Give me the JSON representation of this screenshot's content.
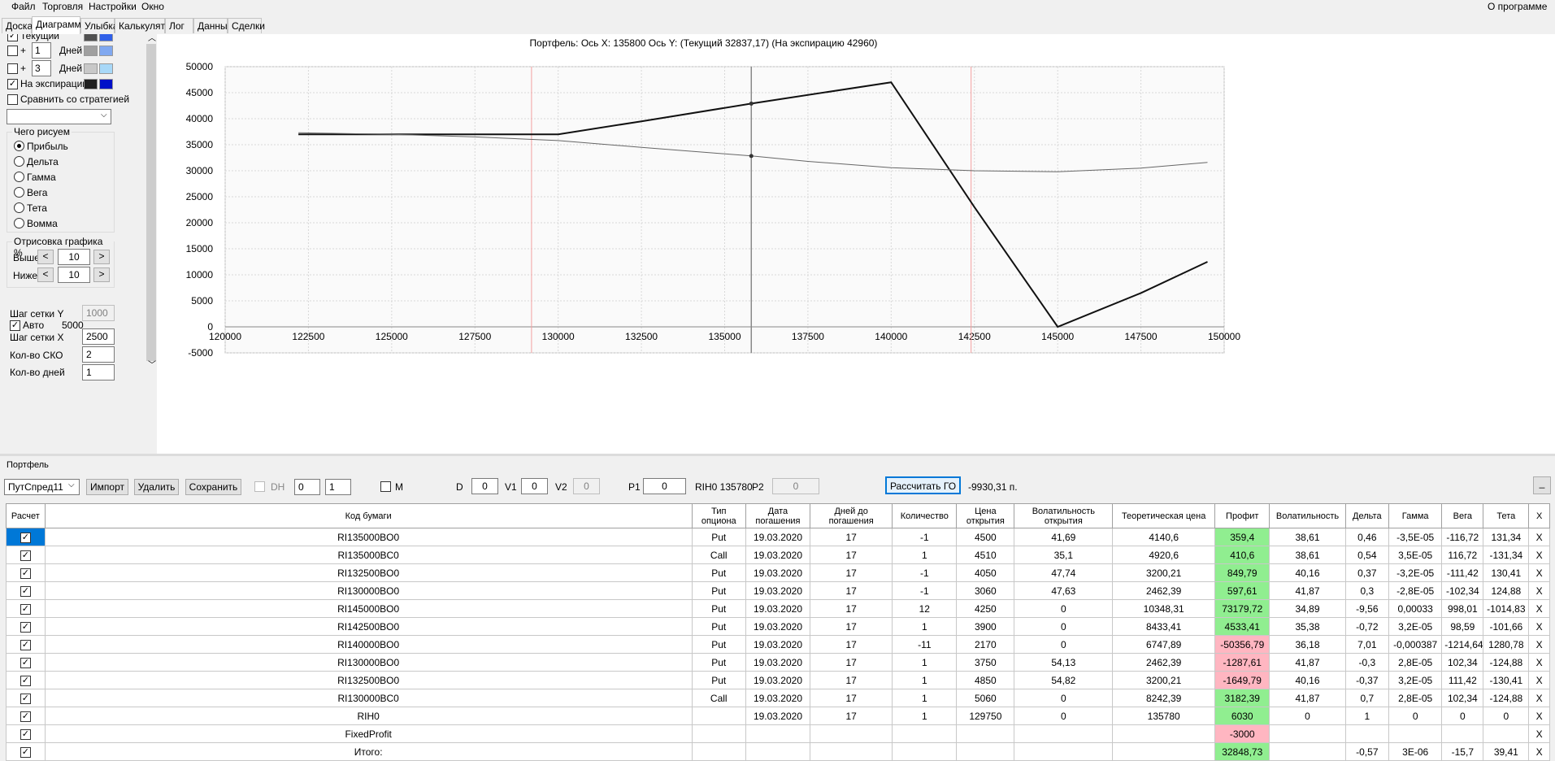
{
  "menu": {
    "file": "Файл",
    "trade": "Торговля",
    "settings": "Настройки",
    "window": "Окно",
    "about": "О программе"
  },
  "tabs": [
    "Доска",
    "Диаграмма",
    "Улыбка",
    "Калькулятор",
    "Лог",
    "Данные",
    "Сделки"
  ],
  "left": {
    "current_label": "Текущий",
    "plus1": "+",
    "plus1_val": "1",
    "days1": "Дней",
    "plus2": "+",
    "plus2_val": "3",
    "days2": "Дней",
    "expiry_label": "На экспирацию",
    "compare_label": "Сравнить со стратегией",
    "draw_group": "Чего рисуем",
    "radios": [
      "Прибыль",
      "Дельта",
      "Гамма",
      "Вега",
      "Тета",
      "Вомма"
    ],
    "render_group": "Отрисовка графика %",
    "above_label": "Выше",
    "above_val": "10",
    "below_label": "Ниже",
    "below_val": "10",
    "lt": "<",
    "gt": ">",
    "grid_y_label": "Шаг сетки Y",
    "grid_y_val": "1000",
    "auto_label": "Авто",
    "auto_val": "5000",
    "grid_x_label": "Шаг сетки X",
    "grid_x_val": "2500",
    "sko_label": "Кол-во СКО",
    "sko_val": "2",
    "days_label": "Кол-во дней",
    "days_val": "1"
  },
  "colors": {
    "current_dark": "#505050",
    "current_light": "#3060e8",
    "plus1_dark": "#a0a0a0",
    "plus1_light": "#80a8f0",
    "plus2_dark": "#c8c8c8",
    "plus2_light": "#a8d8f8",
    "expiry_dark": "#202020",
    "expiry_light": "#0010c8",
    "profit_pos": "#90ee90",
    "profit_neg": "#ffb6c1"
  },
  "chart_data": {
    "type": "line",
    "title": "Портфель: Ось X: 135800 Ось Y:  (Текущий 32837,17)  (На экспирацию 42960)",
    "x_ticks": [
      "120000",
      "122500",
      "125000",
      "127500",
      "130000",
      "132500",
      "135000",
      "137500",
      "140000",
      "142500",
      "145000",
      "147500",
      "150000"
    ],
    "y_ticks": [
      "50000",
      "45000",
      "40000",
      "35000",
      "30000",
      "25000",
      "20000",
      "15000",
      "10000",
      "5000",
      "0",
      "-5000"
    ],
    "xlim": [
      120000,
      150000
    ],
    "ylim": [
      -5000,
      50000
    ],
    "grid": true,
    "cursor_x": 135800,
    "red_lines_x": [
      129200,
      142400
    ],
    "series": [
      {
        "values": [
          [
            122200,
            37000
          ],
          [
            125000,
            37000
          ],
          [
            127500,
            37000
          ],
          [
            130000,
            37000
          ],
          [
            132500,
            39500
          ],
          [
            135800,
            42900
          ],
          [
            140000,
            47000
          ],
          [
            142500,
            23000
          ],
          [
            145000,
            0
          ],
          [
            147500,
            6500
          ],
          [
            149500,
            12500
          ]
        ]
      },
      {
        "values": [
          [
            122200,
            37300
          ],
          [
            125000,
            37000
          ],
          [
            127500,
            36500
          ],
          [
            130000,
            35800
          ],
          [
            132500,
            34500
          ],
          [
            135800,
            32837
          ],
          [
            137500,
            31800
          ],
          [
            140000,
            30600
          ],
          [
            142500,
            30000
          ],
          [
            145000,
            29800
          ],
          [
            147500,
            30500
          ],
          [
            149500,
            31600
          ]
        ]
      }
    ],
    "markers": [
      [
        135800,
        42900
      ],
      [
        135800,
        32837
      ]
    ]
  },
  "portfolio": {
    "section_label": "Портфель",
    "selector": "ПутСпред11",
    "import_btn": "Импорт",
    "delete_btn": "Удалить",
    "save_btn": "Сохранить",
    "dh_label": "DH",
    "dh_v1": "0",
    "dh_v2": "1",
    "m_label": "M",
    "d_label": "D",
    "d_val": "0",
    "v1_label": "V1",
    "v1_val": "0",
    "v2_label": "V2",
    "v2_val": "0",
    "p1_label": "P1",
    "p1_val": "0",
    "rih_label": "RIH0 135780",
    "p2_label": "P2",
    "p2_val": "0",
    "go_btn": "Рассчитать ГО",
    "go_val": "-9930,31 п.",
    "min_btn": "_"
  },
  "table": {
    "headers": [
      "Расчет",
      "Код бумаги",
      "Тип опциона",
      "Дата погашения",
      "Дней до погашения",
      "Количество",
      "Цена открытия",
      "Волатильность открытия",
      "Теоретическая цена",
      "Профит",
      "Волатильность",
      "Дельта",
      "Гамма",
      "Вега",
      "Тета",
      "X"
    ],
    "rows": [
      {
        "code": "RI135000BO0",
        "type": "Put",
        "date": "19.03.2020",
        "days": "17",
        "qty": "-1",
        "open": "4500",
        "vol_open": "41,69",
        "theo": "4140,6",
        "profit": "359,4",
        "sign": "pos",
        "vol": "38,61",
        "delta": "0,46",
        "gamma": "-3,5E-05",
        "vega": "-116,72",
        "theta": "131,34"
      },
      {
        "code": "RI135000BC0",
        "type": "Call",
        "date": "19.03.2020",
        "days": "17",
        "qty": "1",
        "open": "4510",
        "vol_open": "35,1",
        "theo": "4920,6",
        "profit": "410,6",
        "sign": "pos",
        "vol": "38,61",
        "delta": "0,54",
        "gamma": "3,5E-05",
        "vega": "116,72",
        "theta": "-131,34"
      },
      {
        "code": "RI132500BO0",
        "type": "Put",
        "date": "19.03.2020",
        "days": "17",
        "qty": "-1",
        "open": "4050",
        "vol_open": "47,74",
        "theo": "3200,21",
        "profit": "849,79",
        "sign": "pos",
        "vol": "40,16",
        "delta": "0,37",
        "gamma": "-3,2E-05",
        "vega": "-111,42",
        "theta": "130,41"
      },
      {
        "code": "RI130000BO0",
        "type": "Put",
        "date": "19.03.2020",
        "days": "17",
        "qty": "-1",
        "open": "3060",
        "vol_open": "47,63",
        "theo": "2462,39",
        "profit": "597,61",
        "sign": "pos",
        "vol": "41,87",
        "delta": "0,3",
        "gamma": "-2,8E-05",
        "vega": "-102,34",
        "theta": "124,88"
      },
      {
        "code": "RI145000BO0",
        "type": "Put",
        "date": "19.03.2020",
        "days": "17",
        "qty": "12",
        "open": "4250",
        "vol_open": "0",
        "theo": "10348,31",
        "profit": "73179,72",
        "sign": "pos",
        "vol": "34,89",
        "delta": "-9,56",
        "gamma": "0,00033",
        "vega": "998,01",
        "theta": "-1014,83"
      },
      {
        "code": "RI142500BO0",
        "type": "Put",
        "date": "19.03.2020",
        "days": "17",
        "qty": "1",
        "open": "3900",
        "vol_open": "0",
        "theo": "8433,41",
        "profit": "4533,41",
        "sign": "pos",
        "vol": "35,38",
        "delta": "-0,72",
        "gamma": "3,2E-05",
        "vega": "98,59",
        "theta": "-101,66"
      },
      {
        "code": "RI140000BO0",
        "type": "Put",
        "date": "19.03.2020",
        "days": "17",
        "qty": "-11",
        "open": "2170",
        "vol_open": "0",
        "theo": "6747,89",
        "profit": "-50356,79",
        "sign": "neg",
        "vol": "36,18",
        "delta": "7,01",
        "gamma": "-0,000387",
        "vega": "-1214,64",
        "theta": "1280,78"
      },
      {
        "code": "RI130000BO0",
        "type": "Put",
        "date": "19.03.2020",
        "days": "17",
        "qty": "1",
        "open": "3750",
        "vol_open": "54,13",
        "theo": "2462,39",
        "profit": "-1287,61",
        "sign": "neg",
        "vol": "41,87",
        "delta": "-0,3",
        "gamma": "2,8E-05",
        "vega": "102,34",
        "theta": "-124,88"
      },
      {
        "code": "RI132500BO0",
        "type": "Put",
        "date": "19.03.2020",
        "days": "17",
        "qty": "1",
        "open": "4850",
        "vol_open": "54,82",
        "theo": "3200,21",
        "profit": "-1649,79",
        "sign": "neg",
        "vol": "40,16",
        "delta": "-0,37",
        "gamma": "3,2E-05",
        "vega": "111,42",
        "theta": "-130,41"
      },
      {
        "code": "RI130000BC0",
        "type": "Call",
        "date": "19.03.2020",
        "days": "17",
        "qty": "1",
        "open": "5060",
        "vol_open": "0",
        "theo": "8242,39",
        "profit": "3182,39",
        "sign": "pos",
        "vol": "41,87",
        "delta": "0,7",
        "gamma": "2,8E-05",
        "vega": "102,34",
        "theta": "-124,88"
      },
      {
        "code": "RIH0",
        "type": "",
        "date": "19.03.2020",
        "days": "17",
        "qty": "1",
        "open": "129750",
        "vol_open": "0",
        "theo": "135780",
        "profit": "6030",
        "sign": "pos",
        "vol": "0",
        "delta": "1",
        "gamma": "0",
        "vega": "0",
        "theta": "0"
      },
      {
        "code": "FixedProfit",
        "type": "",
        "date": "",
        "days": "",
        "qty": "",
        "open": "",
        "vol_open": "",
        "theo": "",
        "profit": "-3000",
        "sign": "neg",
        "vol": "",
        "delta": "",
        "gamma": "",
        "vega": "",
        "theta": ""
      },
      {
        "code": "Итого:",
        "type": "",
        "date": "",
        "days": "",
        "qty": "",
        "open": "",
        "vol_open": "",
        "theo": "",
        "profit": "32848,73",
        "sign": "pos",
        "vol": "",
        "delta": "-0,57",
        "gamma": "3E-06",
        "vega": "-15,7",
        "theta": "39,41"
      }
    ]
  }
}
